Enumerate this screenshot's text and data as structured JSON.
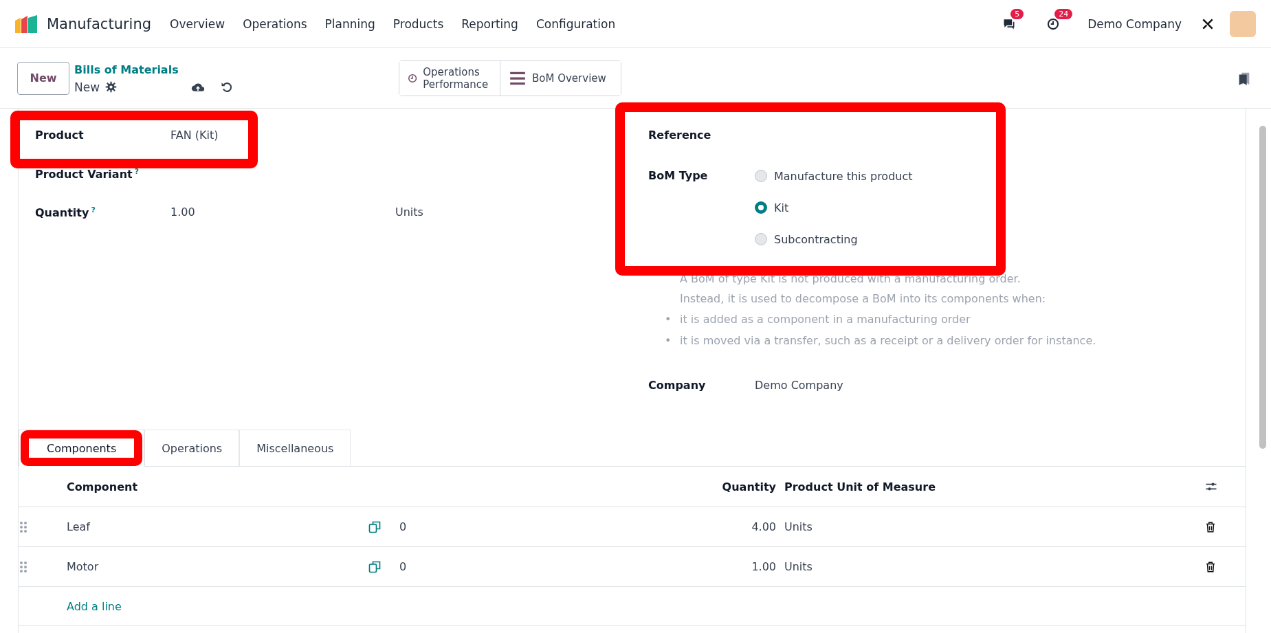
{
  "navbar": {
    "app_name": "Manufacturing",
    "menu": [
      "Overview",
      "Operations",
      "Planning",
      "Products",
      "Reporting",
      "Configuration"
    ],
    "messages_badge": "5",
    "activities_badge": "24",
    "company": "Demo Company"
  },
  "control_panel": {
    "new_button": "New",
    "breadcrumb": "Bills of Materials",
    "record": "New",
    "buttons": [
      {
        "kind": "clock",
        "label": "Operations Performance"
      },
      {
        "kind": "bars",
        "label": "BoM Overview"
      }
    ]
  },
  "form": {
    "left": [
      {
        "label": "Product",
        "value": "FAN (Kit)",
        "highlighted": true
      },
      {
        "label": "Product Variant",
        "help_mark": "?"
      },
      {
        "label": "Quantity",
        "value": "1.00",
        "unit": "Units",
        "help_mark": "?"
      }
    ],
    "reference_label": "Reference",
    "bom_type_label": "BoM Type",
    "bom_highlighted": true,
    "bom_types": [
      {
        "label": "Manufacture this product",
        "selected": false
      },
      {
        "label": "Kit",
        "selected": true
      },
      {
        "label": "Subcontracting",
        "selected": false
      }
    ],
    "help_lines": [
      "A BoM of type Kit is not produced with a manufacturing order.",
      "Instead, it is used to decompose a BoM into its components when:"
    ],
    "help_bullets": [
      {
        "marker": "•",
        "text": "it is added as a component in a manufacturing order"
      },
      {
        "marker": "•",
        "text": "it is moved via a transfer, such as a receipt or a delivery order for instance."
      }
    ],
    "company_label": "Company",
    "company_value": "Demo Company"
  },
  "tabs": [
    {
      "label": "Components",
      "selected": true,
      "highlighted": true
    },
    {
      "label": "Operations",
      "selected": false
    },
    {
      "label": "Miscellaneous",
      "selected": false
    }
  ],
  "table": {
    "columns": [
      "Component",
      "Quantity",
      "Product Unit of Measure"
    ],
    "rows": [
      {
        "component": "Leaf",
        "column_2": "0",
        "quantity": "4.00",
        "unit": "Units"
      },
      {
        "component": "Motor",
        "column_2": "0",
        "quantity": "1.00",
        "unit": "Units"
      }
    ],
    "add_line": "Add a line"
  }
}
